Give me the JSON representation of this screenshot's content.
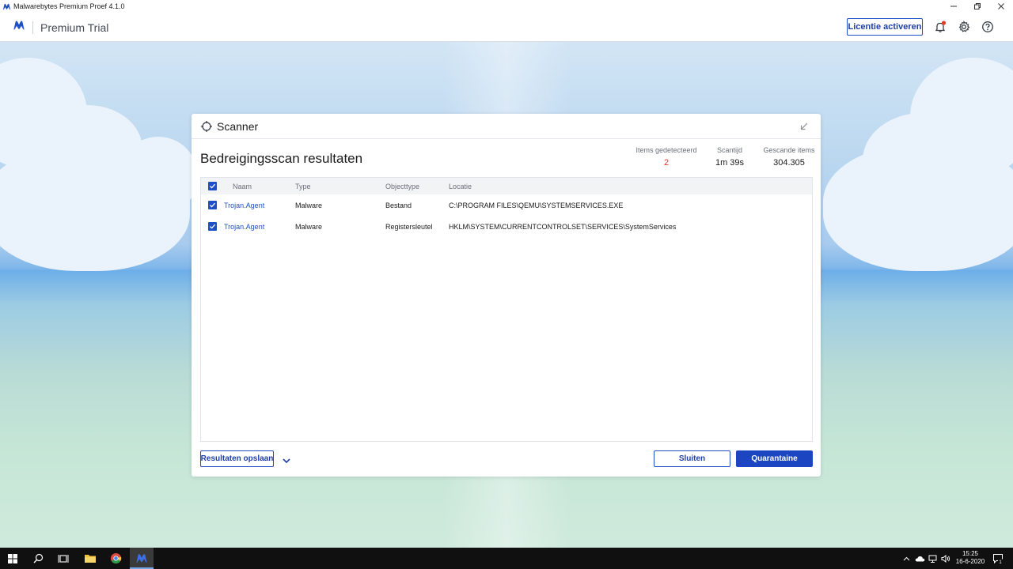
{
  "window": {
    "title": "Malwarebytes Premium Proef  4.1.0"
  },
  "header": {
    "brand_text": "Premium Trial",
    "license_button": "Licentie activeren"
  },
  "dialog": {
    "title": "Scanner",
    "results_title": "Bedreigingsscan resultaten",
    "stats": [
      {
        "label": "Items gedetecteerd",
        "value": "2"
      },
      {
        "label": "Scantijd",
        "value": "1m 39s"
      },
      {
        "label": "Gescande items",
        "value": "304.305"
      }
    ],
    "table": {
      "columns": [
        "Naam",
        "Type",
        "Objecttype",
        "Locatie"
      ],
      "rows": [
        {
          "name": "Trojan.Agent",
          "type": "Malware",
          "objecttype": "Bestand",
          "location": "C:\\PROGRAM FILES\\QEMU\\SYSTEMSERVICES.EXE"
        },
        {
          "name": "Trojan.Agent",
          "type": "Malware",
          "objecttype": "Registersleutel",
          "location": "HKLM\\SYSTEM\\CURRENTCONTROLSET\\SERVICES\\SystemServices"
        }
      ]
    },
    "save_button": "Resultaten opslaan",
    "close_button": "Sluiten",
    "quarantine_button": "Quarantaine"
  },
  "taskbar": {
    "time": "15:25",
    "date": "16-6-2020",
    "notification_count": "1"
  },
  "colors": {
    "accent": "#1c45c2",
    "link": "#1f4fc4",
    "alert": "#d23b2f"
  }
}
